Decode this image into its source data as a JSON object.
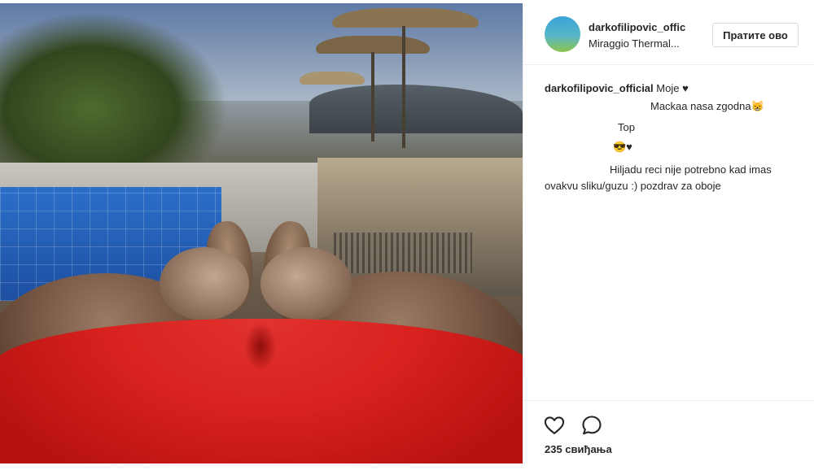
{
  "post": {
    "image_alt": "",
    "likes_label": "235 свиђања"
  },
  "header": {
    "username": "darkofilipovic_offic",
    "location": "Miraggio Thermal...",
    "follow_label": "Пратите ово"
  },
  "comments": [
    {
      "username": "darkofilipovic_official",
      "text": "Moje ♥"
    },
    {
      "text": "Mackaa nasa zgodna😸"
    },
    {
      "text": "Top"
    },
    {
      "text": "😎♥"
    },
    {
      "text": "Hiljadu reci nije potrebno kad imas"
    },
    {
      "text": "ovakvu sliku/guzu :) pozdrav za oboje"
    }
  ],
  "icons": {
    "like": "heart-icon",
    "comment": "comment-bubble-icon"
  }
}
